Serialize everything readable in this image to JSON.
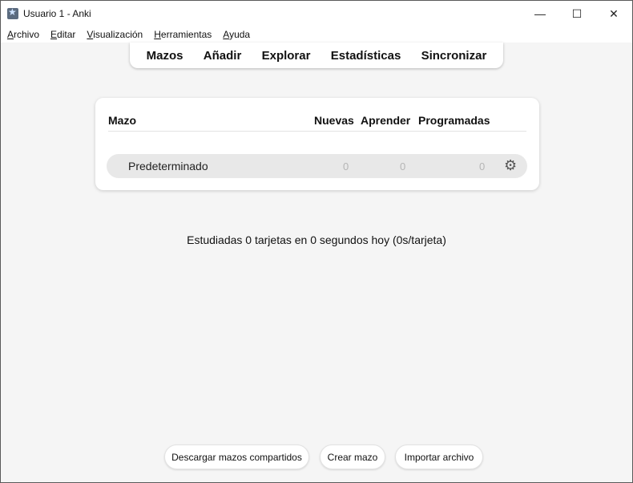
{
  "window": {
    "title": "Usuario 1 - Anki",
    "controls": {
      "minimize": "—",
      "maximize": "☐",
      "close": "✕"
    }
  },
  "menu": [
    {
      "accel": "A",
      "rest": "rchivo"
    },
    {
      "accel": "E",
      "rest": "ditar"
    },
    {
      "accel": "V",
      "rest": "isualización"
    },
    {
      "accel": "H",
      "rest": "erramientas"
    },
    {
      "accel": "A",
      "rest": "yuda"
    }
  ],
  "toolbar": {
    "decks": "Mazos",
    "add": "Añadir",
    "browse": "Explorar",
    "stats": "Estadísticas",
    "sync": "Sincronizar"
  },
  "deck_table": {
    "headers": {
      "deck": "Mazo",
      "new": "Nuevas",
      "learn": "Aprender",
      "due": "Programadas"
    },
    "rows": [
      {
        "name": "Predeterminado",
        "new": "0",
        "learn": "0",
        "due": "0"
      }
    ]
  },
  "study_summary": "Estudiadas 0 tarjetas en 0 segundos hoy (0s/tarjeta)",
  "bottom_buttons": {
    "shared": "Descargar mazos compartidos",
    "create": "Crear mazo",
    "import": "Importar archivo"
  },
  "icons": {
    "app": "anki-star-icon",
    "gear": "gear-icon"
  }
}
